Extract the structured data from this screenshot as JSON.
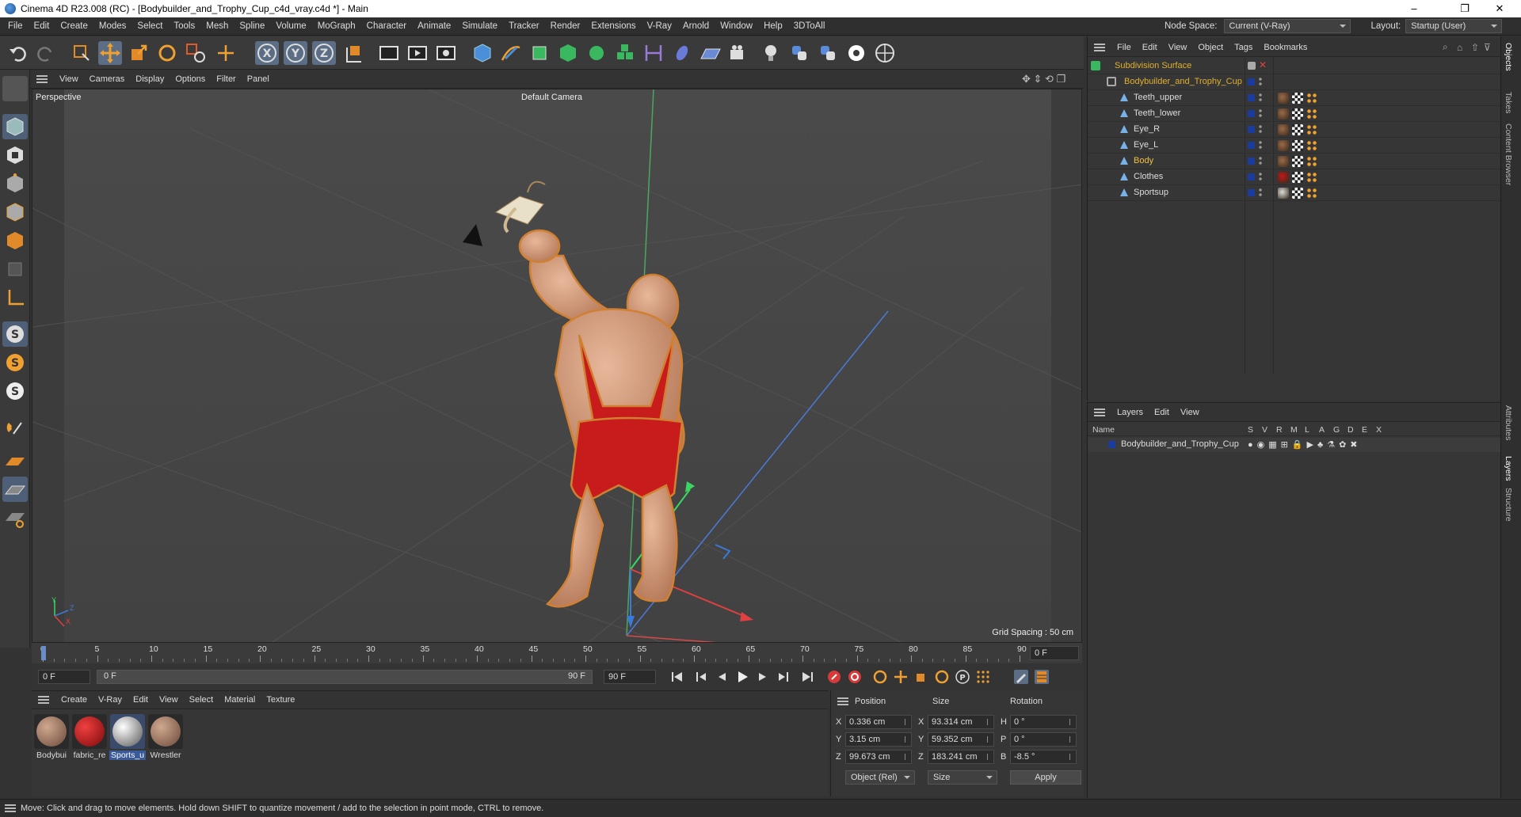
{
  "window": {
    "title": "Cinema 4D R23.008 (RC) - [Bodybuilder_and_Trophy_Cup_c4d_vray.c4d *] - Main",
    "min": "–",
    "max": "❐",
    "close": "✕"
  },
  "menu": {
    "items": [
      "File",
      "Edit",
      "Create",
      "Modes",
      "Select",
      "Tools",
      "Mesh",
      "Spline",
      "Volume",
      "MoGraph",
      "Character",
      "Animate",
      "Simulate",
      "Tracker",
      "Render",
      "Extensions",
      "V-Ray",
      "Arnold",
      "Window",
      "Help",
      "3DToAll"
    ],
    "node_space_label": "Node Space:",
    "node_space_value": "Current (V-Ray)",
    "layout_label": "Layout:",
    "layout_value": "Startup (User)"
  },
  "viewport": {
    "menu": [
      "View",
      "Cameras",
      "Display",
      "Options",
      "Filter",
      "Panel"
    ],
    "view_name": "Perspective",
    "camera": "Default Camera",
    "grid_spacing": "Grid Spacing : 50 cm",
    "axis_y": "Y",
    "axis_z": "Z",
    "axis_x": "X"
  },
  "timeline": {
    "ticks": [
      "0",
      "5",
      "10",
      "15",
      "20",
      "25",
      "30",
      "35",
      "40",
      "45",
      "50",
      "55",
      "60",
      "65",
      "70",
      "75",
      "80",
      "85",
      "90"
    ],
    "current_frame": "0 F"
  },
  "transport": {
    "start": "0 F",
    "range_start": "0 F",
    "range_end": "90 F",
    "end": "90 F"
  },
  "materials": {
    "menu": [
      "Create",
      "V-Ray",
      "Edit",
      "View",
      "Select",
      "Material",
      "Texture"
    ],
    "items": [
      {
        "name": "Bodybui",
        "color": "#8a6a55"
      },
      {
        "name": "fabric_re",
        "color": "#c01818"
      },
      {
        "name": "Sports_u",
        "color": "#d8d8d8"
      },
      {
        "name": "Wrestler",
        "color": "#8a6a55"
      }
    ]
  },
  "coords": {
    "headers": {
      "position": "Position",
      "size": "Size",
      "rotation": "Rotation"
    },
    "rows": [
      {
        "axis": "X",
        "pos": "0.336 cm",
        "saxis": "X",
        "size": "93.314 cm",
        "raxis": "H",
        "rot": "0 °"
      },
      {
        "axis": "Y",
        "pos": "3.15 cm",
        "saxis": "Y",
        "size": "59.352 cm",
        "raxis": "P",
        "rot": "0 °"
      },
      {
        "axis": "Z",
        "pos": "99.673 cm",
        "saxis": "Z",
        "size": "183.241 cm",
        "raxis": "B",
        "rot": "-8.5 °"
      }
    ],
    "mode": "Object (Rel)",
    "size_mode": "Size",
    "apply": "Apply"
  },
  "status": "Move: Click and drag to move elements. Hold down SHIFT to quantize movement / add to the selection in point mode, CTRL to remove.",
  "objects": {
    "menu": [
      "File",
      "Edit",
      "View",
      "Object",
      "Tags",
      "Bookmarks"
    ],
    "items": [
      {
        "name": "Subdivision Surface",
        "indent": 0,
        "color": "#e0b030"
      },
      {
        "name": "Bodybuilder_and_Trophy_Cup",
        "indent": 1,
        "color": "#e0b030"
      },
      {
        "name": "Teeth_upper",
        "indent": 2,
        "color": "#ddd"
      },
      {
        "name": "Teeth_lower",
        "indent": 2,
        "color": "#ddd"
      },
      {
        "name": "Eye_R",
        "indent": 2,
        "color": "#ddd"
      },
      {
        "name": "Eye_L",
        "indent": 2,
        "color": "#ddd"
      },
      {
        "name": "Body",
        "indent": 2,
        "color": "#f0c040"
      },
      {
        "name": "Clothes",
        "indent": 2,
        "color": "#ddd"
      },
      {
        "name": "Sportsup",
        "indent": 2,
        "color": "#ddd"
      }
    ]
  },
  "layers": {
    "menu": [
      "Layers",
      "Edit",
      "View"
    ],
    "name_header": "Name",
    "cols": [
      "S",
      "V",
      "R",
      "M",
      "L",
      "A",
      "G",
      "D",
      "E",
      "X"
    ],
    "items": [
      {
        "name": "Bodybuilder_and_Trophy_Cup"
      }
    ]
  },
  "sidetabs": [
    "Objects",
    "Takes",
    "Content Browser",
    "Attributes",
    "Layers",
    "Structure"
  ]
}
